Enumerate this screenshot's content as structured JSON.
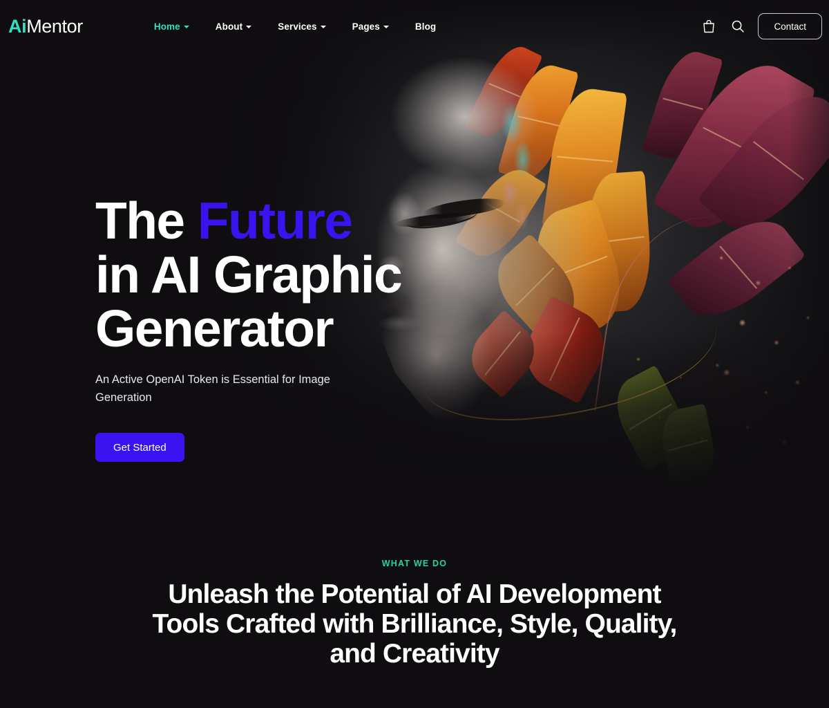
{
  "brand": {
    "prefix": "Ai",
    "suffix": "Mentor"
  },
  "nav": {
    "items": [
      {
        "label": "Home",
        "has_caret": true,
        "active": true
      },
      {
        "label": "About",
        "has_caret": true,
        "active": false
      },
      {
        "label": "Services",
        "has_caret": true,
        "active": false
      },
      {
        "label": "Pages",
        "has_caret": true,
        "active": false
      },
      {
        "label": "Blog",
        "has_caret": false,
        "active": false
      }
    ]
  },
  "header": {
    "cart_icon": "shopping-bag-icon",
    "search_icon": "search-icon",
    "contact_label": "Contact"
  },
  "hero": {
    "title_line1_pre": "The ",
    "title_accent": "Future",
    "title_rest": "\nin AI Graphic\nGenerator",
    "title_full": "The Future in AI Graphic Generator",
    "subtitle": "An Active OpenAI Token is Essential for Image Generation",
    "cta_label": "Get Started"
  },
  "what_we_do": {
    "eyebrow": "WHAT WE DO",
    "heading": "Unleash the Potential of AI Development\nTools Crafted with Brilliance, Style, Quality,\nand Creativity"
  },
  "colors": {
    "background": "#0f0d10",
    "brand_teal": "#2fe0c0",
    "accent_violet": "#3a14f0",
    "eyebrow_green": "#22d79b",
    "text_white": "#ffffff"
  }
}
